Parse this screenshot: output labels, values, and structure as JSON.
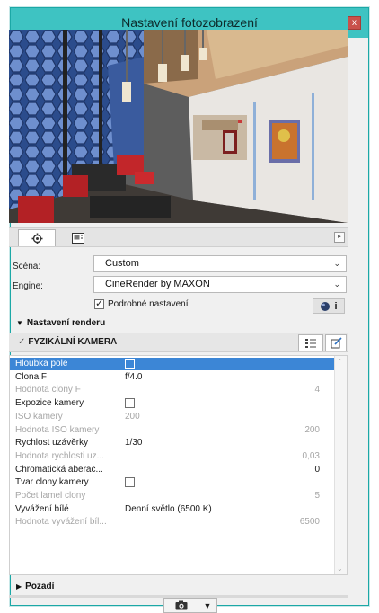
{
  "window": {
    "title": "Nastavení fotozobrazení",
    "close_label": "x"
  },
  "tabs": [
    {
      "name": "settings",
      "icon": "gear-icon"
    },
    {
      "name": "size",
      "icon": "frame-icon"
    }
  ],
  "tab_scroll_label": "▸",
  "scene": {
    "label": "Scéna:",
    "value": "Custom"
  },
  "engine": {
    "label": "Engine:",
    "value": "CineRender by MAXON"
  },
  "detailed_settings": {
    "label": "Podrobné nastavení",
    "checked": true
  },
  "info_button_label": "i",
  "render_settings": {
    "label": "Nastavení renderu",
    "expanded": true
  },
  "physical_camera": {
    "label": "FYZIKÁLNÍ KAMERA",
    "checked": true
  },
  "params": [
    {
      "name": "Hloubka pole",
      "value": "",
      "num": "",
      "checkbox": true,
      "checked": false,
      "state": "selected"
    },
    {
      "name": "Clona F",
      "value": "f/4.0",
      "num": "",
      "checkbox": false,
      "state": "normal"
    },
    {
      "name": "Hodnota clony F",
      "value": "",
      "num": "4",
      "checkbox": false,
      "state": "dim"
    },
    {
      "name": "Expozice kamery",
      "value": "",
      "num": "",
      "checkbox": true,
      "checked": false,
      "state": "normal"
    },
    {
      "name": "ISO kamery",
      "value": "200",
      "num": "",
      "checkbox": false,
      "state": "dim"
    },
    {
      "name": "Hodnota ISO kamery",
      "value": "",
      "num": "200",
      "checkbox": false,
      "state": "dim"
    },
    {
      "name": "Rychlost uzávěrky",
      "value": "1/30",
      "num": "",
      "checkbox": false,
      "state": "normal"
    },
    {
      "name": "Hodnota rychlosti uz...",
      "value": "",
      "num": "0,03",
      "checkbox": false,
      "state": "dim"
    },
    {
      "name": "Chromatická aberac...",
      "value": "",
      "num": "0",
      "checkbox": false,
      "state": "normal"
    },
    {
      "name": "Tvar clony kamery",
      "value": "",
      "num": "",
      "checkbox": true,
      "checked": false,
      "state": "normal"
    },
    {
      "name": "Počet lamel clony",
      "value": "",
      "num": "5",
      "checkbox": false,
      "state": "dim"
    },
    {
      "name": "Vyvážení bílé",
      "value": "Denní světlo (6500 K)",
      "num": "",
      "checkbox": false,
      "state": "normal"
    },
    {
      "name": "Hodnota vyvážení bíl...",
      "value": "",
      "num": "6500",
      "checkbox": false,
      "state": "dim"
    }
  ],
  "background_section": {
    "label": "Pozadí",
    "expanded": false
  },
  "colors": {
    "titlebar": "#3ec3c2",
    "selection": "#3c86d6",
    "close": "#c9514b"
  }
}
